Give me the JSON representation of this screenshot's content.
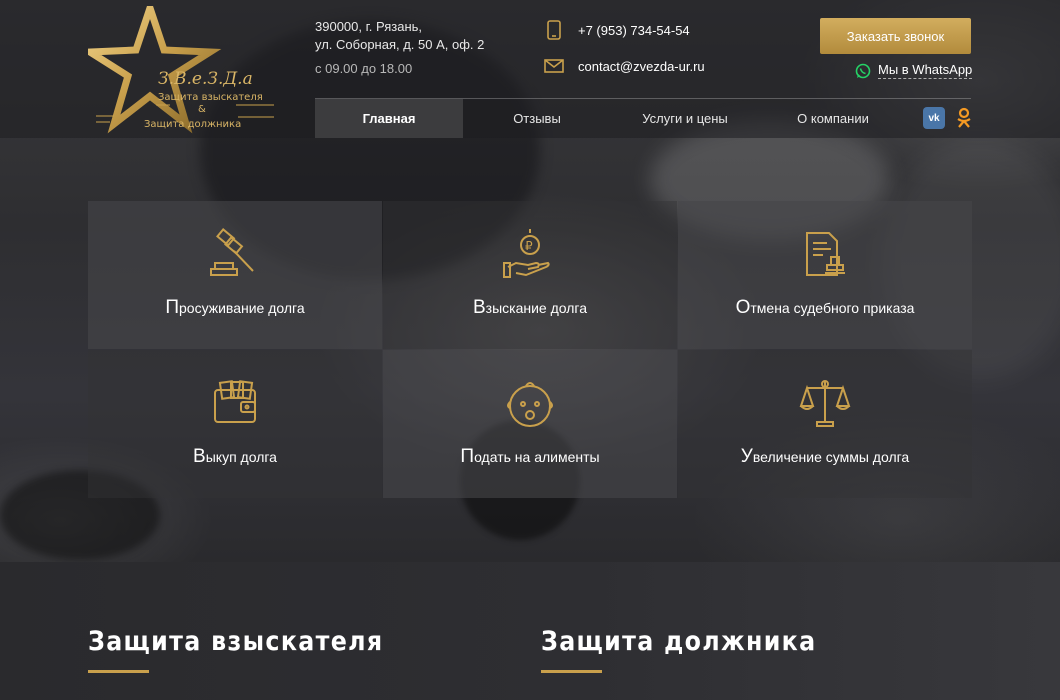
{
  "colors": {
    "accent_gold": "#c9a04c",
    "button_gold": "#c19a4a",
    "vk_blue": "#4a76a8",
    "whatsapp_green": "#25d366"
  },
  "logo": {
    "brand": "З.В.е.З.Д.а",
    "line1": "Защита взыскателя",
    "amp": "&",
    "line2": "Защита должника"
  },
  "header": {
    "address_line1": "390000, г. Рязань,",
    "address_line2": "ул. Соборная, д. 50 А, оф. 2",
    "hours": "с 09.00 до 18.00",
    "phone": "+7 (953) 734-54-54",
    "email": "contact@zvezda-ur.ru",
    "callback_label": "Заказать звонок",
    "whatsapp_label": "Мы в WhatsApp",
    "vk_label": "vk"
  },
  "nav": [
    {
      "label": "Главная",
      "active": true
    },
    {
      "label": "Отзывы"
    },
    {
      "label": "Услуги и цены"
    },
    {
      "label": "О компании"
    }
  ],
  "services": [
    {
      "label": "Просуживание долга",
      "icon": "gavel-icon"
    },
    {
      "label": "Взыскание долга",
      "icon": "coin-hand-icon"
    },
    {
      "label": "Отмена судебного приказа",
      "icon": "stamped-document-icon"
    },
    {
      "label": "Выкуп долга",
      "icon": "wallet-icon"
    },
    {
      "label": "Подать на алименты",
      "icon": "baby-face-icon"
    },
    {
      "label": "Увеличение суммы долга",
      "icon": "scales-icon"
    }
  ],
  "sections": {
    "creditor_title": "Защита взыскателя",
    "debtor_title": "Защита должника"
  }
}
